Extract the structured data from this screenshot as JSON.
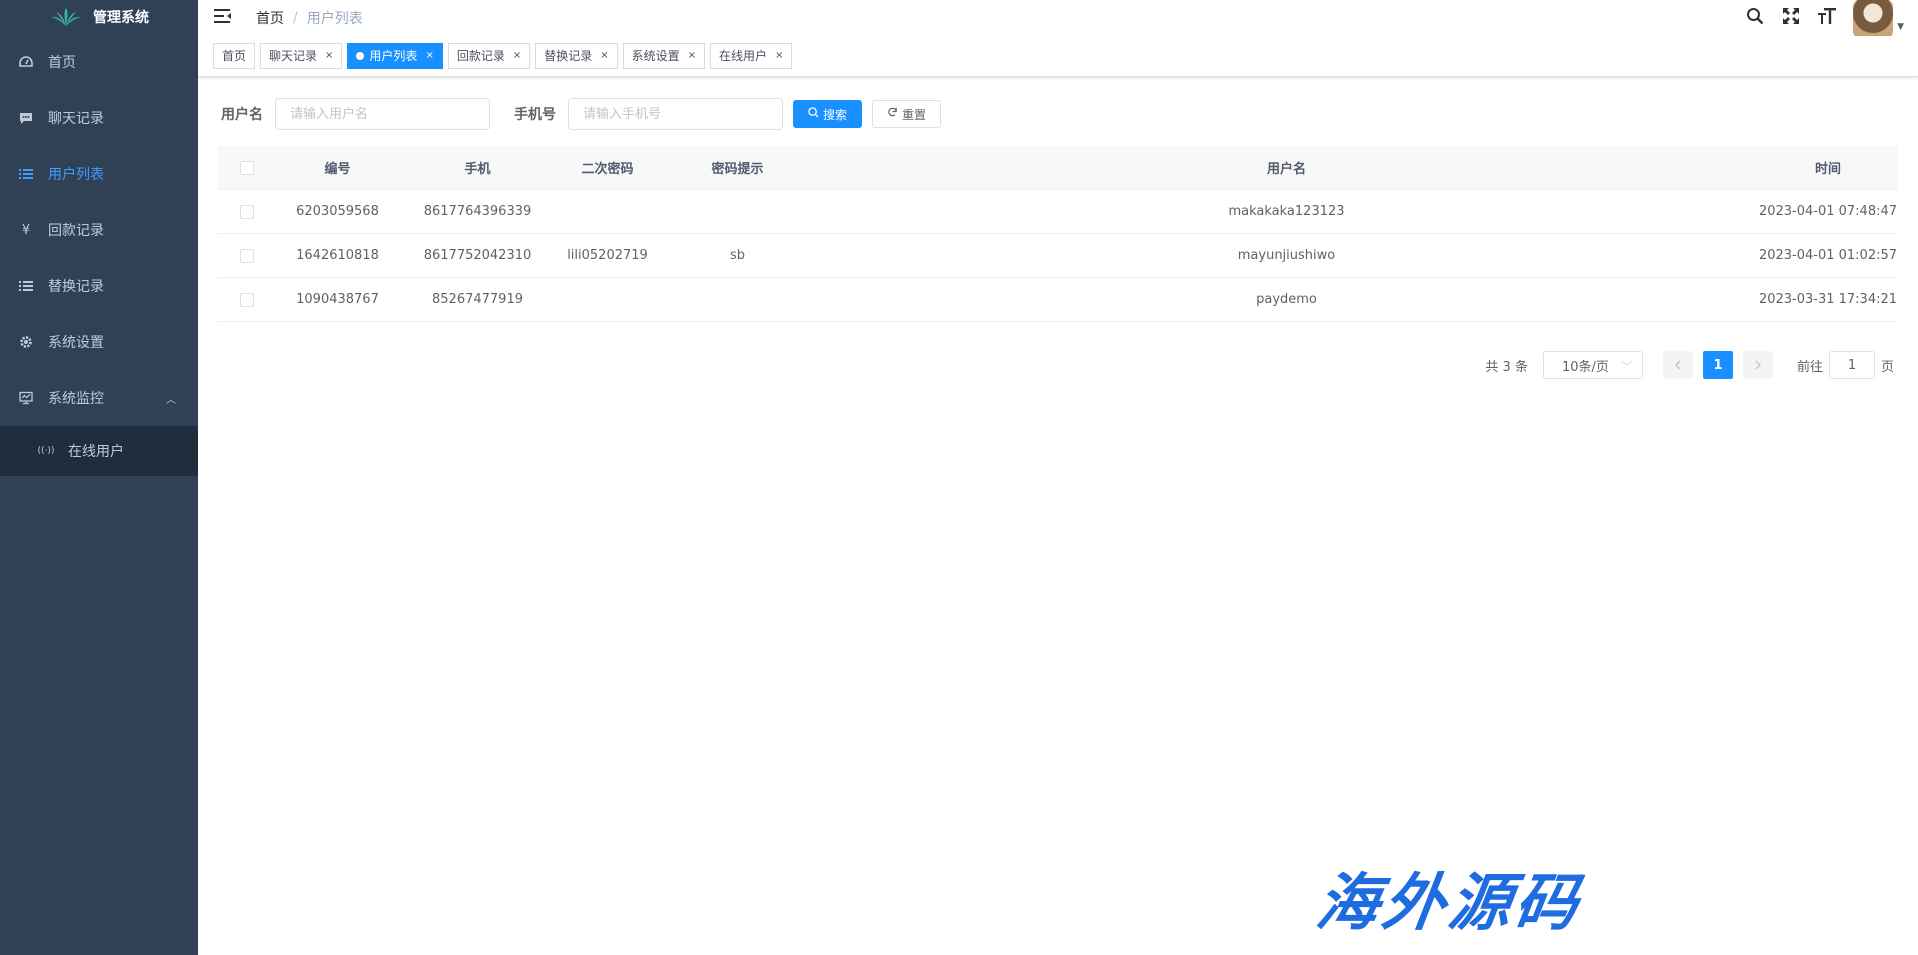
{
  "app": {
    "title": "管理系统",
    "logo_icon": "grass-leaf-logo-icon"
  },
  "sidebar": {
    "items": [
      {
        "label": "首页",
        "icon": "dashboard-icon"
      },
      {
        "label": "聊天记录",
        "icon": "chat-icon"
      },
      {
        "label": "用户列表",
        "icon": "list-icon",
        "active": true
      },
      {
        "label": "回款记录",
        "icon": "yen-icon"
      },
      {
        "label": "替换记录",
        "icon": "list-icon"
      },
      {
        "label": "系统设置",
        "icon": "gear-icon"
      },
      {
        "label": "系统监控",
        "icon": "monitor-icon",
        "expanded": true
      }
    ],
    "submenu": [
      {
        "label": "在线用户",
        "icon": "online-icon"
      }
    ]
  },
  "breadcrumb": {
    "home": "首页",
    "separator": "/",
    "current": "用户列表"
  },
  "tags": [
    {
      "label": "首页",
      "closable": false
    },
    {
      "label": "聊天记录",
      "closable": true
    },
    {
      "label": "用户列表",
      "closable": true,
      "active": true
    },
    {
      "label": "回款记录",
      "closable": true
    },
    {
      "label": "替换记录",
      "closable": true
    },
    {
      "label": "系统设置",
      "closable": true
    },
    {
      "label": "在线用户",
      "closable": true
    }
  ],
  "search": {
    "username_label": "用户名",
    "username_placeholder": "请输入用户名",
    "phone_label": "手机号",
    "phone_placeholder": "请输入手机号",
    "search_button": "搜索",
    "reset_button": "重置"
  },
  "table": {
    "columns": [
      "编号",
      "手机",
      "二次密码",
      "密码提示",
      "用户名",
      "时间"
    ],
    "rows": [
      [
        "6203059568",
        "8617764396339",
        "",
        "",
        "makakaka123123",
        "2023-04-01 07:48:47"
      ],
      [
        "1642610818",
        "8617752042310",
        "lili05202719",
        "sb",
        "mayunjiushiwo",
        "2023-04-01 01:02:57"
      ],
      [
        "1090438767",
        "85267477919",
        "",
        "",
        "paydemo",
        "2023-03-31 17:34:21"
      ]
    ]
  },
  "pagination": {
    "total": "共 3 条",
    "page_size": "10条/页",
    "current_page": "1",
    "goto_prefix": "前往",
    "goto_value": "1",
    "goto_suffix": "页"
  },
  "watermark": "海外源码",
  "colors": {
    "sidebar_bg": "#304156",
    "accent": "#1890ff",
    "active_menu": "#409eff"
  }
}
